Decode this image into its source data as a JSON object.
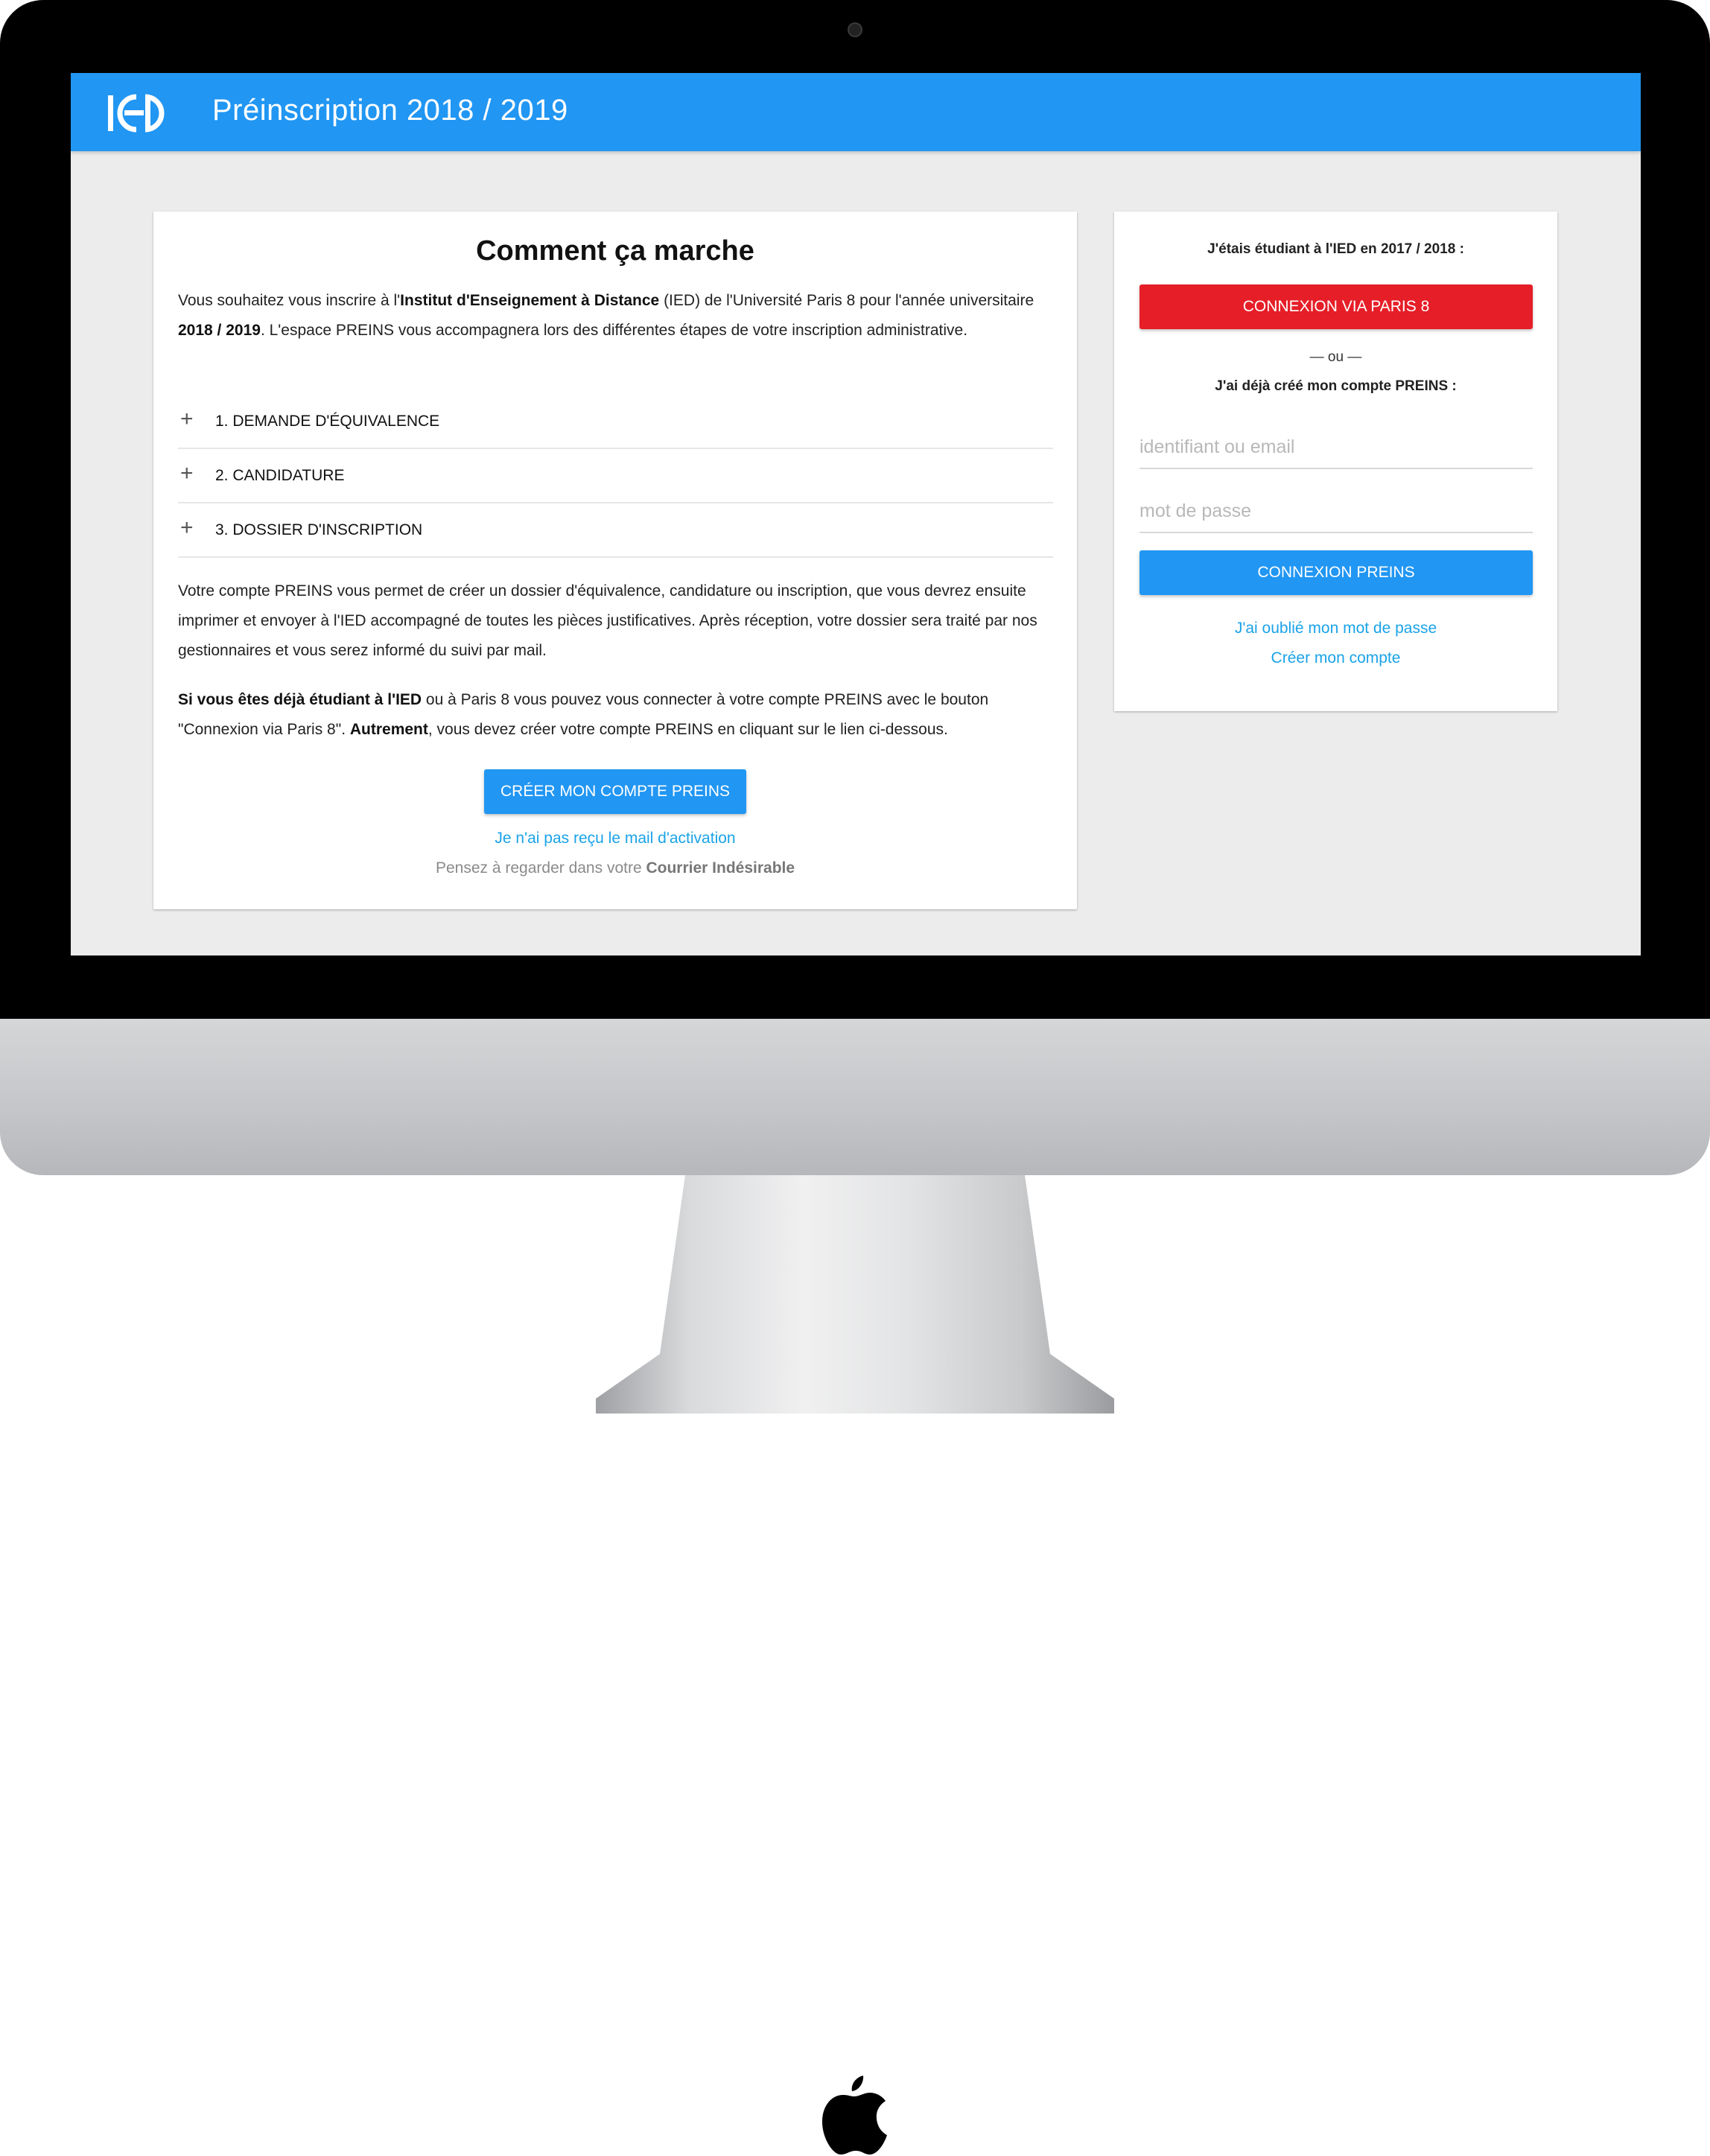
{
  "header": {
    "logo_text": "IED",
    "title": "Préinscription 2018 / 2019"
  },
  "main": {
    "title": "Comment ça marche",
    "intro": {
      "t1": "Vous souhaitez vous inscrire à l'",
      "b1": "Institut d'Enseignement à Distance",
      "t2": " (IED) de l'Université Paris 8 pour l'année universitaire ",
      "b2": "2018 / 2019",
      "t3": ". L'espace PREINS vous accompagnera lors des différentes étapes de votre inscription administrative."
    },
    "steps": [
      {
        "label": "1. DEMANDE D'ÉQUIVALENCE"
      },
      {
        "label": "2. CANDIDATURE"
      },
      {
        "label": "3. DOSSIER D'INSCRIPTION"
      }
    ],
    "desc": "Votre compte PREINS vous permet de créer un dossier d'équivalence, candidature ou inscription, que vous devrez ensuite imprimer et envoyer à l'IED accompagné de toutes les pièces justificatives. Après réception, votre dossier sera traité par nos gestionnaires et vous serez informé du suivi par mail.",
    "info": {
      "b1": "Si vous êtes déjà étudiant à l'IED",
      "t1": " ou à Paris 8 vous pouvez vous connecter à votre compte PREINS avec le bouton \"Connexion via Paris 8\". ",
      "b2": "Autrement",
      "t2": ", vous devez créer votre compte PREINS en cliquant sur le lien ci-dessous."
    },
    "create_button": "CRÉER MON COMPTE PREINS",
    "activation_link": "Je n'ai pas reçu le mail d'activation",
    "spam_note": {
      "text": "Pensez à regarder dans votre ",
      "bold": "Courrier Indésirable"
    }
  },
  "sidebar": {
    "former_student_heading": "J'étais étudiant à l'IED en 2017 / 2018 :",
    "paris8_button": "CONNEXION VIA PARIS 8",
    "or_text": "— ou —",
    "existing_account_heading": "J'ai déjà créé mon compte PREINS :",
    "username_placeholder": "identifiant ou email",
    "password_placeholder": "mot de passe",
    "login_button": "CONNEXION PREINS",
    "forgot_link": "J'ai oublié mon mot de passe",
    "create_link": "Créer mon compte"
  },
  "colors": {
    "primary": "#2196f3",
    "danger": "#e61e28",
    "link": "#1aa3e8",
    "background": "#ececec"
  }
}
